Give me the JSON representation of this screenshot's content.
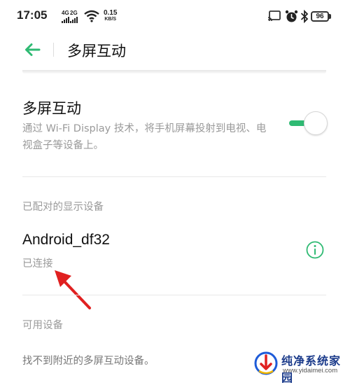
{
  "status_bar": {
    "time": "17:05",
    "signal1_label": "4G",
    "signal2_label": "2G",
    "net_speed_value": "0.15",
    "net_speed_unit": "KB/S",
    "battery": "96"
  },
  "header": {
    "title": "多屏互动"
  },
  "main_setting": {
    "title": "多屏互动",
    "description": "通过 Wi-Fi Display 技术，将手机屏幕投射到电视、电视盒子等设备上。",
    "toggle_on": true
  },
  "paired_section": {
    "header": "已配对的显示设备",
    "device": {
      "name": "Android_df32",
      "status": "已连接"
    }
  },
  "available_section": {
    "header": "可用设备",
    "empty_text": "找不到附近的多屏互动设备。"
  },
  "watermark": {
    "title": "纯净系统家园",
    "url": "www.yidaimei.com"
  },
  "colors": {
    "accent": "#2fba73",
    "annotation_arrow": "#e02020"
  }
}
